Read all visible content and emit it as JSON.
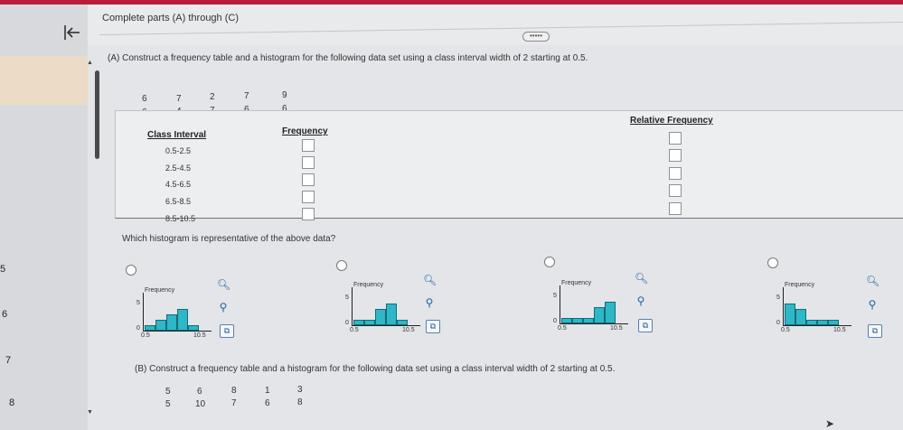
{
  "header": {
    "title": "Complete parts (A) through (C)",
    "more_label": "•••••"
  },
  "left_panel": {
    "numbers": [
      "5",
      "6",
      "7",
      "8"
    ]
  },
  "partA": {
    "title": "(A) Construct a frequency table and a histogram for the following data set using a class interval width of 2 starting at 0.5.",
    "data_rows": [
      [
        "6",
        "7",
        "2",
        "7",
        "9"
      ],
      [
        "6",
        "4",
        "7",
        "6",
        "6"
      ]
    ],
    "table": {
      "col_class": "Class Interval",
      "col_freq": "Frequency",
      "col_rel": "Relative Frequency",
      "intervals": [
        "0.5-2.5",
        "2.5-4.5",
        "4.5-6.5",
        "6.5-8.5",
        "8.5-10.5"
      ]
    },
    "question": "Which histogram is representative of the above data?",
    "options": [
      {
        "ylabel": "Frequency",
        "ytick": "5",
        "y0": "0",
        "xmin": "0.5",
        "xmax": "10.5",
        "values": [
          1,
          2,
          3,
          4,
          1
        ]
      },
      {
        "ylabel": "Frequency",
        "ytick": "5",
        "y0": "0",
        "xmin": "0.5",
        "xmax": "10.5",
        "values": [
          1,
          1,
          3,
          4,
          1
        ]
      },
      {
        "ylabel": "Frequency",
        "ytick": "5",
        "y0": "0",
        "xmin": "0.5",
        "xmax": "10.5",
        "values": [
          1,
          1,
          1,
          3,
          4
        ]
      },
      {
        "ylabel": "Frequency",
        "ytick": "5",
        "y0": "0",
        "xmin": "0.5",
        "xmax": "10.5",
        "values": [
          4,
          3,
          1,
          1,
          1
        ]
      }
    ]
  },
  "partB": {
    "title": "(B) Construct a frequency table and a histogram for the following data set using a class interval width of 2 starting at 0.5.",
    "data_rows": [
      [
        "5",
        "6",
        "8",
        "1",
        "3"
      ],
      [
        "5",
        "10",
        "7",
        "6",
        "8"
      ]
    ]
  },
  "icons": {
    "zoom": "magnify-icon",
    "zoom_out": "zoom-out-icon",
    "popout": "popout-icon"
  }
}
